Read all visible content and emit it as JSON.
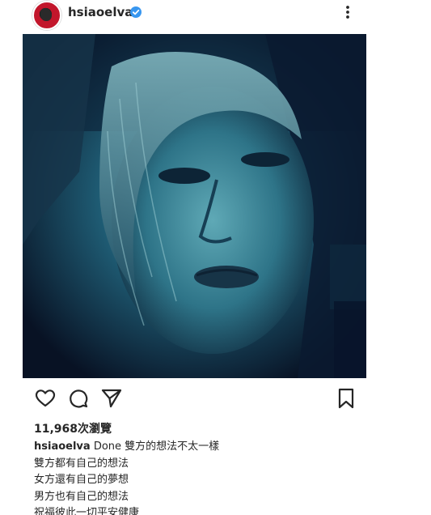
{
  "post": {
    "username": "hsiaoelva",
    "verified": true,
    "views": "11,968次瀏覽",
    "caption_first": "Done 雙方的想法不太一樣",
    "caption_lines": [
      "雙方都有自己的想法",
      "女方還有自己的夢想",
      "男方也有自己的想法",
      "祝福彼此一切平安健康"
    ]
  },
  "icons": {
    "more": "more-vertical-icon",
    "like": "heart-icon",
    "comment": "comment-icon",
    "share": "send-icon",
    "save": "bookmark-icon",
    "verified": "verified-badge-icon"
  },
  "colors": {
    "text": "#262626",
    "verified": "#3897f0",
    "photo_tint": "#1e6f84"
  }
}
